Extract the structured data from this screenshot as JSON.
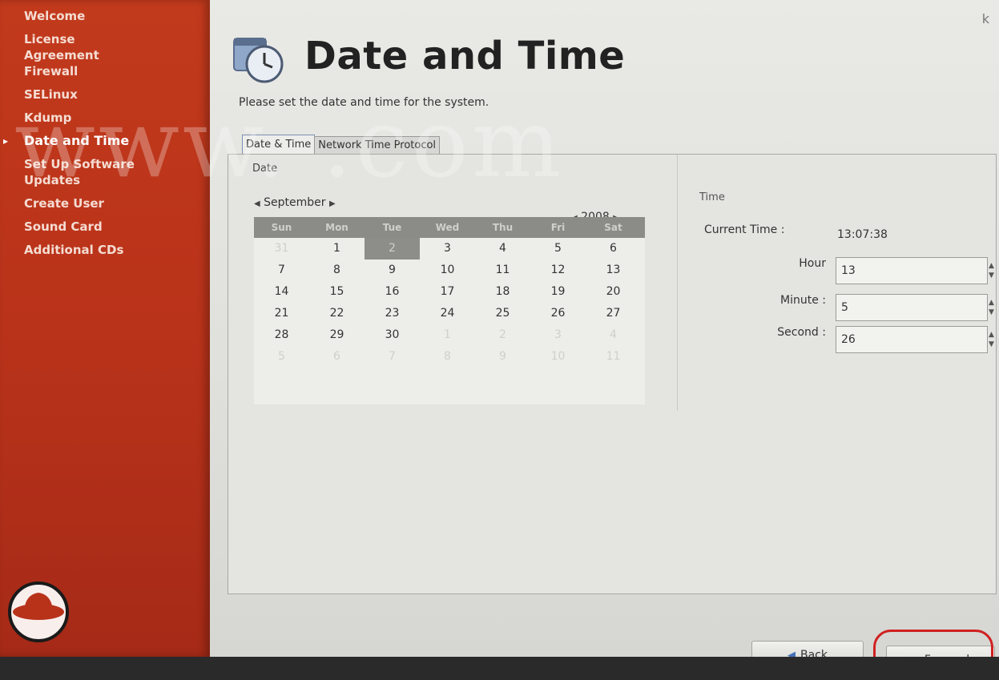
{
  "sidebar": {
    "items": [
      {
        "label": "Welcome"
      },
      {
        "label": "License",
        "label2": "Agreement"
      },
      {
        "label": "Firewall"
      },
      {
        "label": "SELinux"
      },
      {
        "label": "Kdump"
      },
      {
        "label": "Date and Time",
        "current": true
      },
      {
        "label": "Set Up Software",
        "label2": "Updates"
      },
      {
        "label": "Create User"
      },
      {
        "label": "Sound Card"
      },
      {
        "label": "Additional CDs"
      }
    ],
    "logo_icon": "redhat-shadowman-icon"
  },
  "header": {
    "title": "Date and Time",
    "description": "Please set the date and time for the system.",
    "icon": "clock-calendar-icon"
  },
  "tabs": [
    {
      "label": "Date & Time",
      "active": true
    },
    {
      "label": "Network Time Protocol",
      "active": false
    }
  ],
  "date": {
    "group_label": "Date",
    "month": "September",
    "year": "2008",
    "weekdays": [
      "Sun",
      "Mon",
      "Tue",
      "Wed",
      "Thu",
      "Fri",
      "Sat"
    ],
    "weeks": [
      [
        "31",
        "1",
        "2",
        "3",
        "4",
        "5",
        "6"
      ],
      [
        "7",
        "8",
        "9",
        "10",
        "11",
        "12",
        "13"
      ],
      [
        "14",
        "15",
        "16",
        "17",
        "18",
        "19",
        "20"
      ],
      [
        "21",
        "22",
        "23",
        "24",
        "25",
        "26",
        "27"
      ],
      [
        "28",
        "29",
        "30",
        "1",
        "2",
        "3",
        "4"
      ],
      [
        "5",
        "6",
        "7",
        "8",
        "9",
        "10",
        "11"
      ]
    ],
    "selected_day": "2"
  },
  "time": {
    "group_label": "Time",
    "current_time_label": "Current Time :",
    "current_time_value": "13:07:38",
    "hour_label": "Hour",
    "hour_value": "13",
    "minute_label": "Minute :",
    "minute_value": "5",
    "second_label": "Second :",
    "second_value": "26"
  },
  "buttons": {
    "back_label": "Back",
    "forward_label": "Forward"
  },
  "watermark": "www.          .com",
  "colors": {
    "sidebar": "#b8321a",
    "highlight": "#d02020",
    "selected_day": "#8d8d89"
  }
}
